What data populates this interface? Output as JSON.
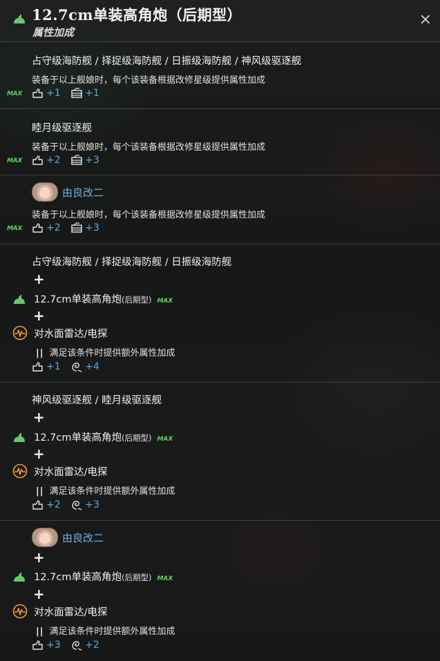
{
  "header": {
    "title": "12.7cm单装高角炮（后期型）",
    "subtitle": "属性加成",
    "close_label": "×"
  },
  "max_label": "MAX",
  "plus_glyph": "+",
  "cond_glyph": "||",
  "sections": [
    {
      "ships": "占守级海防舰 / 择捉级海防舰 / 日振级海防舰 / 神风级驱逐舰",
      "desc": "装备于以上舰娘时，每个该装备根据改修星级提供属性加成",
      "stat1": "+1",
      "stat2": "+1"
    },
    {
      "ships": "睦月级驱逐舰",
      "desc": "装备于以上舰娘时，每个该装备根据改修星级提供属性加成",
      "stat1": "+2",
      "stat2": "+3"
    },
    {
      "ship_name": "由良改二",
      "desc": "装备于以上舰娘时，每个该装备根据改修星级提供属性加成",
      "stat1": "+2",
      "stat2": "+3"
    },
    {
      "ships": "占守级海防舰 / 择捉级海防舰 / 日振级海防舰",
      "equip": "12.7cm单装高角炮",
      "equip_suffix": "(后期型)",
      "radar": "对水面雷达/电探",
      "cond": "满足该条件时提供额外属性加成",
      "stat1": "+1",
      "stat2": "+4"
    },
    {
      "ships": "神风级驱逐舰 / 睦月级驱逐舰",
      "equip": "12.7cm单装高角炮",
      "equip_suffix": "(后期型)",
      "radar": "对水面雷达/电探",
      "cond": "满足该条件时提供额外属性加成",
      "stat1": "+2",
      "stat2": "+3"
    },
    {
      "ship_name": "由良改二",
      "equip": "12.7cm单装高角炮",
      "equip_suffix": "(后期型)",
      "radar": "对水面雷达/电探",
      "cond": "满足该条件时提供额外属性加成",
      "stat1": "+3",
      "stat2": "+2"
    }
  ],
  "colors": {
    "stat_blue": "#5aa9e6",
    "ship_blue": "#6ab0e8",
    "max_green": "#5bd45b",
    "gun_green": "#66c86a",
    "radar_orange": "#f0a030"
  }
}
